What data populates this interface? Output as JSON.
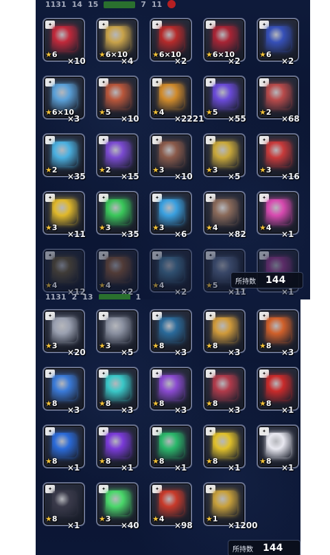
{
  "top_strip": {
    "values": [
      "1131",
      "14",
      "15",
      "7",
      "11"
    ]
  },
  "top_items": [
    {
      "name": "dark-crystal-red",
      "rarity": "6",
      "mult": "",
      "count": "×10",
      "color": "#c0283a"
    },
    {
      "name": "summon-ticket-gold",
      "rarity": "6",
      "mult": "×10",
      "count": "×4",
      "color": "#c9a34a"
    },
    {
      "name": "red-orb-ticket",
      "rarity": "6",
      "mult": "×10",
      "count": "×2",
      "color": "#b52a2a"
    },
    {
      "name": "dark-crystal-red-2",
      "rarity": "6",
      "mult": "×10",
      "count": "×2",
      "color": "#a82434"
    },
    {
      "name": "dark-crystal-blue",
      "rarity": "6",
      "mult": "",
      "count": "×2",
      "color": "#3650b8"
    },
    {
      "name": "crystal-ticket-blue",
      "rarity": "6",
      "mult": "×10",
      "count": "×3",
      "color": "#5aa0d8"
    },
    {
      "name": "summon-ticket-red",
      "rarity": "5",
      "mult": "",
      "count": "×10",
      "color": "#b8563a"
    },
    {
      "name": "elixir",
      "rarity": "4",
      "mult": "",
      "count": "×2221",
      "color": "#d08a2a"
    },
    {
      "name": "magic-orb",
      "rarity": "5",
      "mult": "",
      "count": "×55",
      "color": "#6a4ad8"
    },
    {
      "name": "meat",
      "rarity": "2",
      "mult": "",
      "count": "×68",
      "color": "#b84a4a"
    },
    {
      "name": "blue-potion",
      "rarity": "2",
      "mult": "",
      "count": "×35",
      "color": "#4ab0e0"
    },
    {
      "name": "purple-crystal",
      "rarity": "2",
      "mult": "",
      "count": "×15",
      "color": "#7a4ad0"
    },
    {
      "name": "horn",
      "rarity": "3",
      "mult": "",
      "count": "×10",
      "color": "#8a5a4a"
    },
    {
      "name": "gold-ore",
      "rarity": "3",
      "mult": "",
      "count": "×5",
      "color": "#c9a83a"
    },
    {
      "name": "red-gem-paper",
      "rarity": "3",
      "mult": "",
      "count": "×16",
      "color": "#c83a3a"
    },
    {
      "name": "golden-apple",
      "rarity": "3",
      "mult": "",
      "count": "×11",
      "color": "#e0b82a"
    },
    {
      "name": "green-potion",
      "rarity": "3",
      "mult": "",
      "count": "×35",
      "color": "#3ac85a"
    },
    {
      "name": "blue-bone",
      "rarity": "3",
      "mult": "",
      "count": "×6",
      "color": "#3aa0e0"
    },
    {
      "name": "map-scroll",
      "rarity": "4",
      "mult": "",
      "count": "×82",
      "color": "#8a6a5a"
    },
    {
      "name": "pink-potion",
      "rarity": "4",
      "mult": "",
      "count": "×1",
      "color": "#d84ab0"
    },
    {
      "name": "faded-item-1",
      "rarity": "4",
      "mult": "",
      "count": "×12",
      "color": "#6a5a3a"
    },
    {
      "name": "faded-item-2",
      "rarity": "4",
      "mult": "",
      "count": "×2",
      "color": "#8a5a3a"
    },
    {
      "name": "faded-item-3",
      "rarity": "4",
      "mult": "",
      "count": "×2",
      "color": "#4a7a9a"
    },
    {
      "name": "faded-item-4",
      "rarity": "5",
      "mult": "",
      "count": "×11",
      "color": "#5a6a8a"
    },
    {
      "name": "faded-item-5",
      "rarity": "",
      "mult": "",
      "count": "×1",
      "color": "#9a3a8a"
    }
  ],
  "top_holding": {
    "label": "所持数",
    "value": "144"
  },
  "mid_strip": {
    "values": [
      "1131",
      "2",
      "13",
      "1"
    ]
  },
  "bottom_items": [
    {
      "name": "silver-crystal",
      "rarity": "3",
      "count": "×20",
      "color": "#9aa0b0"
    },
    {
      "name": "silver-emblem",
      "rarity": "3",
      "count": "×5",
      "color": "#8a90a0"
    },
    {
      "name": "blue-gem-cluster",
      "rarity": "8",
      "count": "×3",
      "color": "#2a6a9a"
    },
    {
      "name": "golden-honeycomb",
      "rarity": "8",
      "count": "×3",
      "color": "#d09a3a"
    },
    {
      "name": "flame-blade",
      "rarity": "8",
      "count": "×3",
      "color": "#d0602a"
    },
    {
      "name": "blue-crystal-shard",
      "rarity": "8",
      "count": "×3",
      "color": "#3a7ad8"
    },
    {
      "name": "cyan-ring",
      "rarity": "8",
      "count": "×3",
      "color": "#3ac8c8"
    },
    {
      "name": "purple-burst",
      "rarity": "8",
      "count": "×3",
      "color": "#8a4ad0"
    },
    {
      "name": "red-mech-claw",
      "rarity": "8",
      "count": "×3",
      "color": "#b03a4a"
    },
    {
      "name": "red-orb",
      "rarity": "8",
      "count": "×1",
      "color": "#c82a2a"
    },
    {
      "name": "blue-orb",
      "rarity": "8",
      "count": "×1",
      "color": "#2a6ad8"
    },
    {
      "name": "purple-orb",
      "rarity": "8",
      "count": "×1",
      "color": "#7a3ad8"
    },
    {
      "name": "green-orb",
      "rarity": "8",
      "count": "×1",
      "color": "#2ab86a"
    },
    {
      "name": "yellow-orb",
      "rarity": "8",
      "count": "×1",
      "color": "#e0c02a"
    },
    {
      "name": "white-orb",
      "rarity": "8",
      "count": "×1",
      "color": "#e8e8f0"
    },
    {
      "name": "black-orb",
      "rarity": "8",
      "count": "×1",
      "color": "#3a3a4a"
    },
    {
      "name": "green-sparkle",
      "rarity": "3",
      "count": "×40",
      "color": "#4ad86a"
    },
    {
      "name": "red-ticket",
      "rarity": "4",
      "count": "×98",
      "color": "#c83a2a"
    },
    {
      "name": "golden-statue",
      "rarity": "1",
      "count": "×1200",
      "color": "#c8a03a"
    }
  ],
  "bottom_holding": {
    "label": "所持数",
    "value": "144"
  }
}
